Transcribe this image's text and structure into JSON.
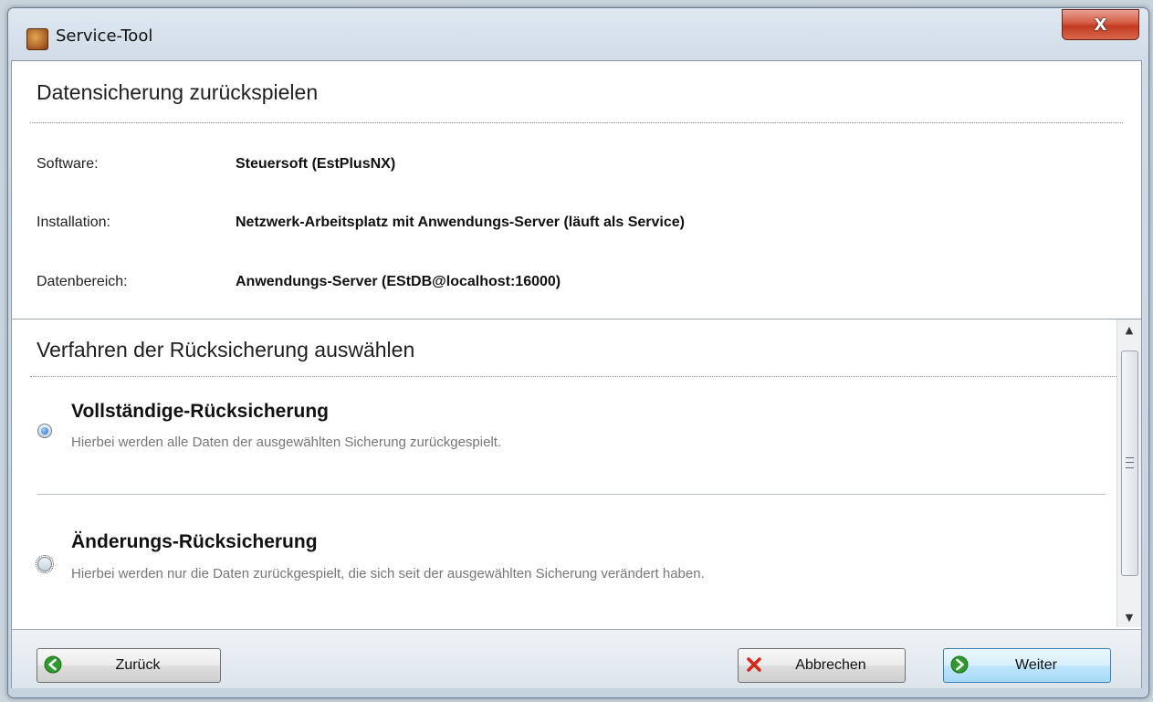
{
  "window": {
    "title": "Service-Tool",
    "close_label": "X"
  },
  "info": {
    "heading": "Datensicherung zurückspielen",
    "rows": [
      {
        "label": "Software:",
        "value": "Steuersoft (EstPlusNX)"
      },
      {
        "label": "Installation:",
        "value": "Netzwerk-Arbeitsplatz mit Anwendungs-Server (läuft als Service)"
      },
      {
        "label": "Datenbereich:",
        "value": "Anwendungs-Server (EStDB@localhost:16000)"
      }
    ]
  },
  "options": {
    "heading": "Verfahren der Rücksicherung auswählen",
    "items": [
      {
        "title": "Vollständige-Rücksicherung",
        "description": "Hierbei werden alle Daten der ausgewählten Sicherung zurückgespielt.",
        "selected": true
      },
      {
        "title": "Änderungs-Rücksicherung",
        "description": "Hierbei werden nur die Daten zurückgespielt, die sich seit der ausgewählten Sicherung verändert haben.",
        "selected": false
      }
    ]
  },
  "buttons": {
    "back": "Zurück",
    "cancel": "Abbrechen",
    "next": "Weiter"
  },
  "colors": {
    "accent": "#1f6fc4",
    "icon_green": "#2f9b2f",
    "icon_red": "#d8261b"
  }
}
